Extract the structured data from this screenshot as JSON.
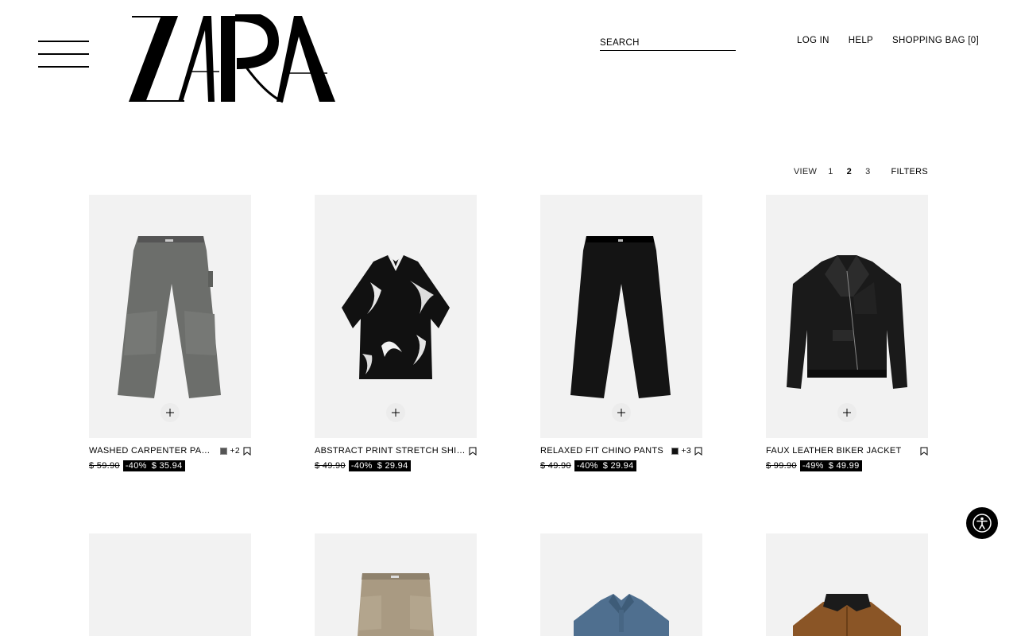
{
  "header": {
    "logo_text": "ZARA",
    "search_placeholder": "SEARCH",
    "login": "LOG IN",
    "help": "HELP",
    "bag": "SHOPPING BAG [0]"
  },
  "viewbar": {
    "view_label": "VIEW",
    "options": [
      "1",
      "2",
      "3"
    ],
    "active_option": "2",
    "filters": "FILTERS"
  },
  "products": [
    {
      "name": "WASHED CARPENTER PANTS",
      "old_price": "$ 59.90",
      "discount": "-40%",
      "price": "$ 35.94",
      "swatch_color": "#555555",
      "more_colors": "+2"
    },
    {
      "name": "ABSTRACT PRINT STRETCH SHIRT",
      "old_price": "$ 49.90",
      "discount": "-40%",
      "price": "$ 29.94"
    },
    {
      "name": "RELAXED FIT CHINO PANTS",
      "old_price": "$ 49.90",
      "discount": "-40%",
      "price": "$ 29.94",
      "swatch_color": "#111111",
      "more_colors": "+3"
    },
    {
      "name": "FAUX LEATHER BIKER JACKET",
      "old_price": "$ 99.90",
      "discount": "-49%",
      "price": "$ 49.99"
    }
  ],
  "colors": {
    "image_background": "#f2f2f2",
    "sale_background": "#000000"
  },
  "icons": {
    "menu": "hamburger-menu-icon",
    "add": "plus-icon",
    "bookmark": "bookmark-icon",
    "accessibility": "accessibility-icon"
  }
}
